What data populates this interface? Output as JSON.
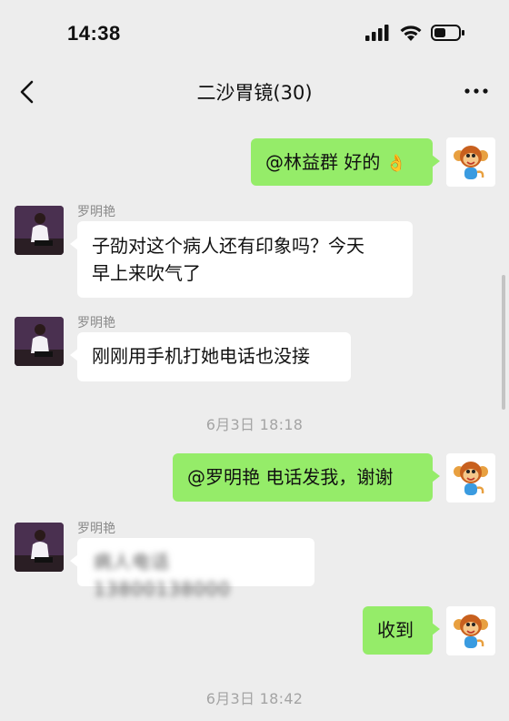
{
  "status": {
    "time": "14:38"
  },
  "nav": {
    "title": "二沙胃镜(30)"
  },
  "messages": {
    "m1": {
      "text": "@林益群 好的",
      "emoji": "👌"
    },
    "m2": {
      "sender": "罗明艳",
      "line1": "子劭对这个病人还有印象吗？今天",
      "line2": "早上来吹气了"
    },
    "m3": {
      "sender": "罗明艳",
      "text": "刚刚用手机打她电话也没接"
    },
    "t1": {
      "text": "6月3日 18:18"
    },
    "m4": {
      "text": "@罗明艳 电话发我，谢谢"
    },
    "m5": {
      "sender": "罗明艳",
      "text": "病人电话 13800138000"
    },
    "m6": {
      "text": "收到"
    },
    "t2": {
      "text": "6月3日 18:42"
    }
  },
  "colors": {
    "bubble_green": "#95ec69",
    "background": "#ededed"
  }
}
